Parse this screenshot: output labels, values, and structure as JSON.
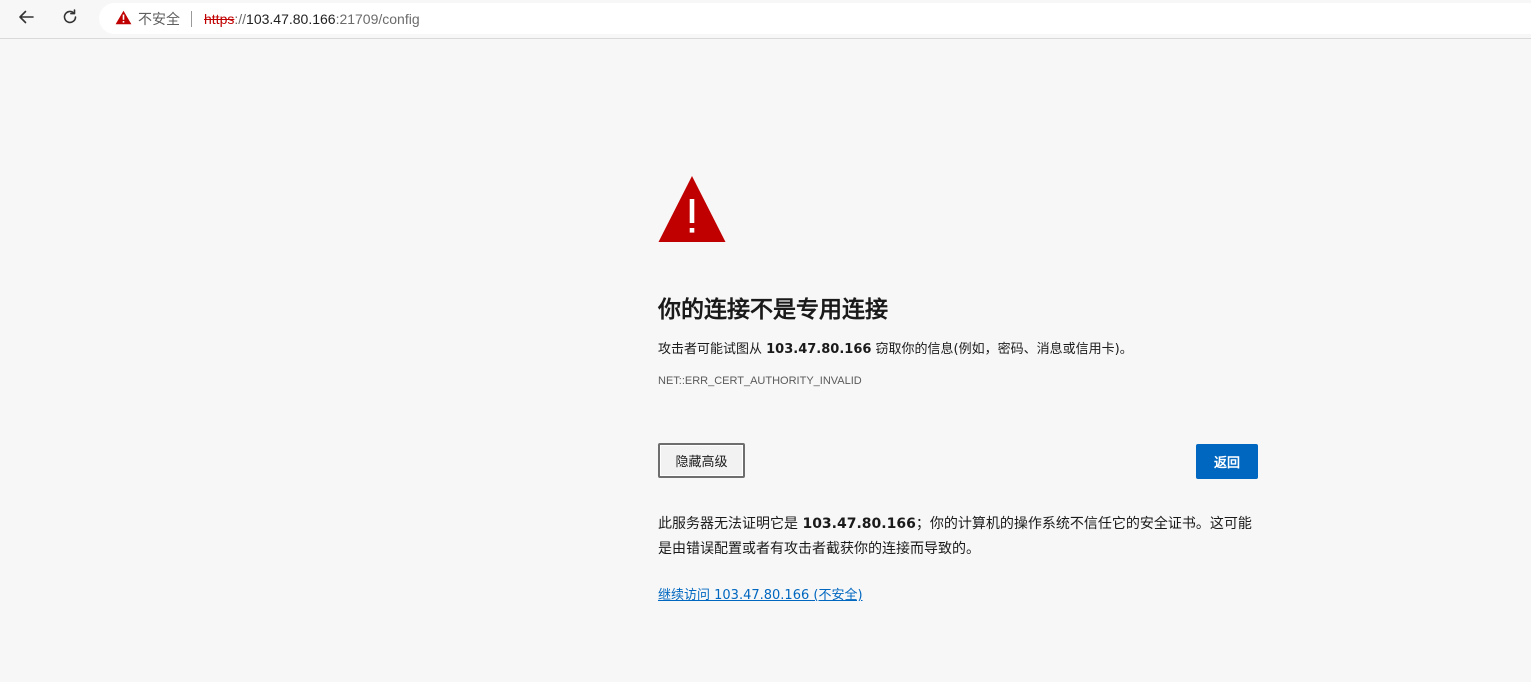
{
  "browser": {
    "security_label": "不安全",
    "url": {
      "scheme": "https",
      "separator": "://",
      "host": "103.47.80.166",
      "rest": ":21709/config"
    },
    "icons": {
      "back": "arrow-left-icon",
      "reload": "reload-icon",
      "security": "warning-triangle-icon"
    }
  },
  "interstitial": {
    "title": "你的连接不是专用连接",
    "description": {
      "before": "攻击者可能试图从 ",
      "host": "103.47.80.166",
      "after": " 窃取你的信息(例如，密码、消息或信用卡)。"
    },
    "error_code": "NET::ERR_CERT_AUTHORITY_INVALID",
    "advanced_button": "隐藏高级",
    "back_button": "返回",
    "details": {
      "before": "此服务器无法证明它是 ",
      "host": "103.47.80.166",
      "after": "；你的计算机的操作系统不信任它的安全证书。这可能是由错误配置或者有攻击者截获你的连接而导致的。"
    },
    "proceed_link": "继续访问 103.47.80.166 (不安全)"
  },
  "colors": {
    "warning_red": "#c00000",
    "accent_blue": "#0067c0",
    "background": "#f7f7f7"
  }
}
